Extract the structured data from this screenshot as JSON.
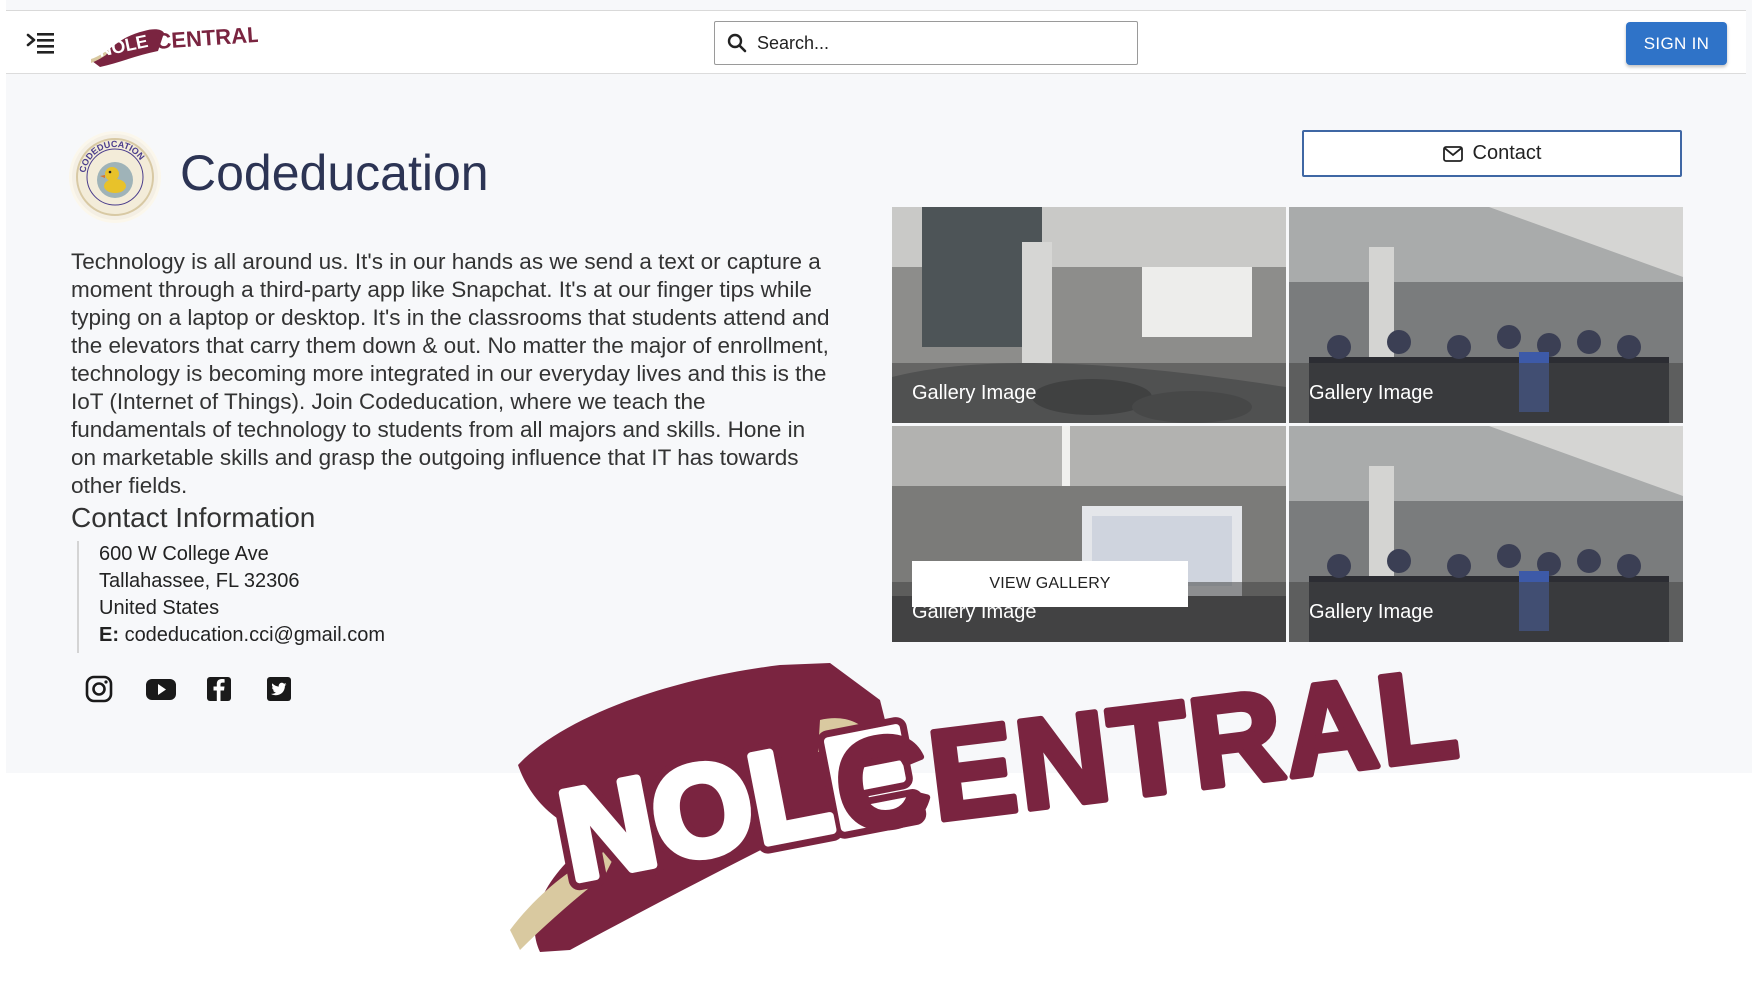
{
  "header": {
    "logo_text": "NOLE CENTRAL",
    "search_placeholder": "Search...",
    "sign_in_label": "SIGN IN"
  },
  "club": {
    "name": "Codeducation",
    "logo_text": "CODEDUCATION",
    "description": "Technology is all around us. It's in our hands as we send a text or capture a moment through a third-party app like Snapchat. It's at our finger tips while typing on a laptop or desktop. It's in the classrooms that students attend and the elevators that carry them down & out. No matter the major of enrollment, technology is becoming more integrated in our everyday lives and this is the IoT (Internet of Things). Join Codeducation, where we teach the fundamentals of technology to students from all majors and skills. Hone in on marketable skills and grasp the outgoing influence that IT has towards other fields."
  },
  "contact": {
    "heading": "Contact Information",
    "address_line1": "600 W College Ave",
    "address_line2": "Tallahassee, FL 32306",
    "country": "United States",
    "email_label": "E:",
    "email": "codeducation.cci@gmail.com",
    "button_label": "Contact"
  },
  "socials": [
    "instagram-icon",
    "youtube-icon",
    "facebook-icon",
    "twitter-icon"
  ],
  "gallery": {
    "captions": [
      "Gallery Image",
      "Gallery Image",
      "Gallery Image",
      "Gallery Image"
    ],
    "view_label": "VIEW GALLERY"
  },
  "overlay_logo": {
    "word1": "NOLE",
    "word2": "CENTRAL"
  },
  "colors": {
    "garnet": "#7a2440",
    "gold": "#d9c9a0",
    "primary_blue": "#2f73c8"
  }
}
